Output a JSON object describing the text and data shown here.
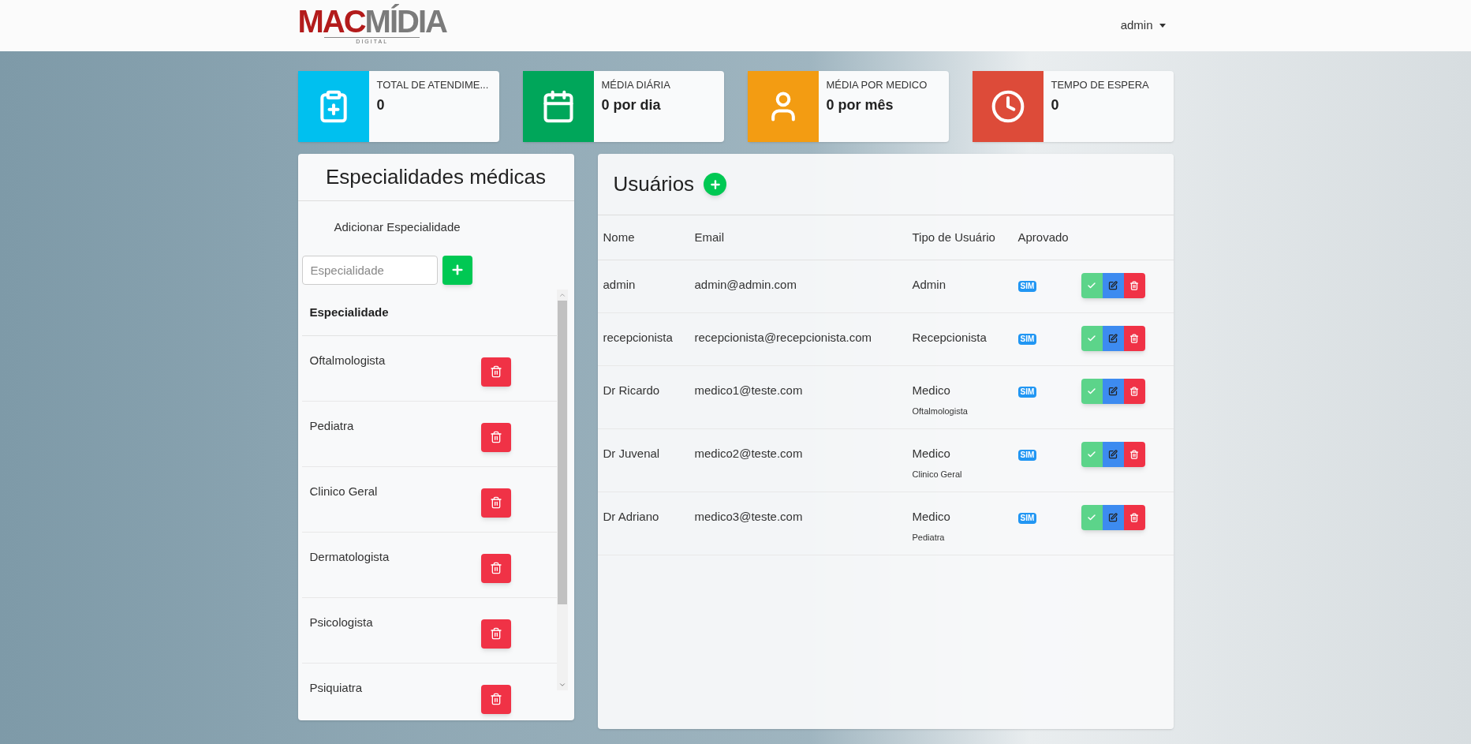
{
  "header": {
    "logo": {
      "part_1": "MAC",
      "part_2": "MÍDIA",
      "tagline": "DIGITAL"
    },
    "user_menu": {
      "label": "admin"
    }
  },
  "stats": [
    {
      "kind": "clipboard",
      "color": "#00c0ef",
      "label": "TOTAL DE ATENDIME...",
      "value": "0"
    },
    {
      "kind": "calendar",
      "color": "#00a65a",
      "label": "MÉDIA DIÁRIA",
      "value": "0 por dia"
    },
    {
      "kind": "user",
      "color": "#f39c12",
      "label": "MÉDIA POR MEDICO",
      "value": "0 por mês"
    },
    {
      "kind": "clock",
      "color": "#dd4b39",
      "label": "TEMPO DE ESPERA",
      "value": "0"
    }
  ],
  "specialties_panel": {
    "title": "Especialidades médicas",
    "add_label": "Adicionar Especialidade",
    "input": {
      "placeholder": "Especialidade"
    },
    "column": "Especialidade",
    "items": [
      {
        "name": "Oftalmologista"
      },
      {
        "name": "Pediatra"
      },
      {
        "name": "Clinico Geral"
      },
      {
        "name": "Dermatologista"
      },
      {
        "name": "Psicologista"
      },
      {
        "name": "Psiquiatra"
      }
    ]
  },
  "users_panel": {
    "title": "Usuários",
    "columns": [
      "Nome",
      "Email",
      "Tipo de Usuário",
      "Aprovado"
    ],
    "rows": [
      {
        "name": "admin",
        "email": "admin@admin.com",
        "type": "Admin",
        "approved": "SIM"
      },
      {
        "name": "recepcionista",
        "email": "recepcionista@recepcionista.com",
        "type": "Recepcionista",
        "approved": "SIM"
      },
      {
        "name": "Dr Ricardo",
        "email": "medico1@teste.com",
        "type": "Medico",
        "specialty": "Oftalmologista",
        "approved": "SIM"
      },
      {
        "name": "Dr Juvenal",
        "email": "medico2@teste.com",
        "type": "Medico",
        "specialty": "Clinico Geral",
        "approved": "SIM"
      },
      {
        "name": "Dr Adriano",
        "email": "medico3@teste.com",
        "type": "Medico",
        "specialty": "Pediatra",
        "approved": "SIM"
      }
    ]
  }
}
